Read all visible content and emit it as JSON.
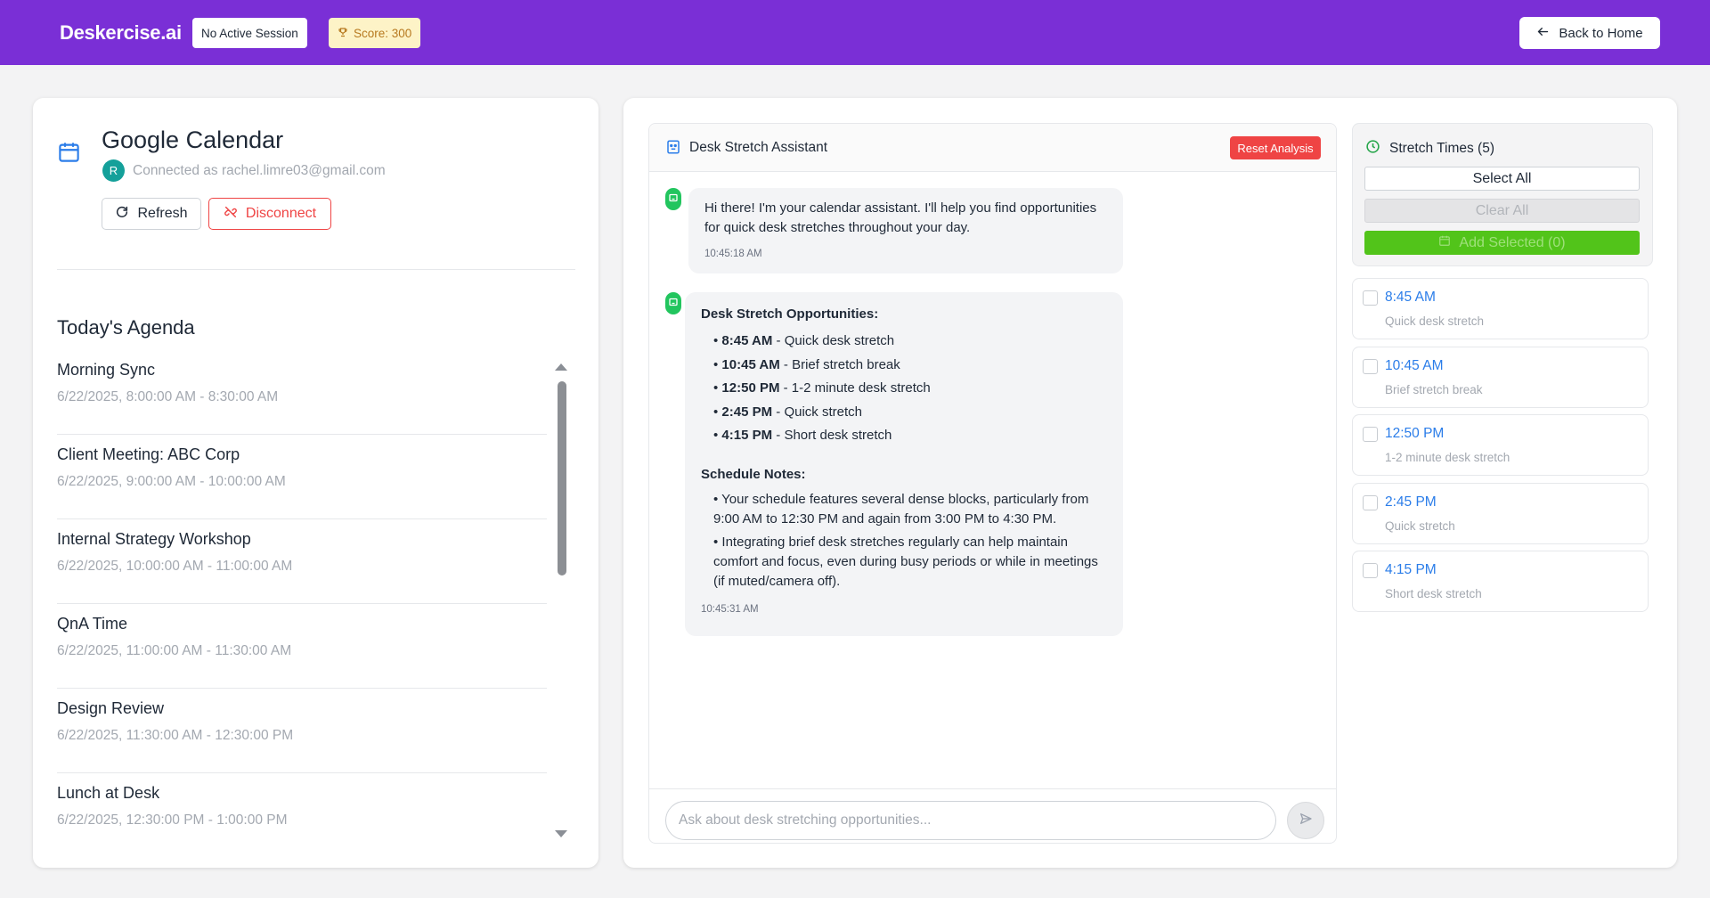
{
  "header": {
    "brand": "Deskercise.ai",
    "session_status": "No Active Session",
    "score_label": "Score: 300",
    "back_button": "Back to Home"
  },
  "calendar": {
    "title": "Google Calendar",
    "avatar_initial": "R",
    "connected_as": "Connected as rachel.limre03@gmail.com",
    "refresh_label": "Refresh",
    "disconnect_label": "Disconnect",
    "agenda_title": "Today's Agenda",
    "agenda": [
      {
        "name": "Morning Sync",
        "time": "6/22/2025, 8:00:00 AM - 8:30:00 AM"
      },
      {
        "name": "Client Meeting: ABC Corp",
        "time": "6/22/2025, 9:00:00 AM - 10:00:00 AM"
      },
      {
        "name": "Internal Strategy Workshop",
        "time": "6/22/2025, 10:00:00 AM - 11:00:00 AM"
      },
      {
        "name": "QnA Time",
        "time": "6/22/2025, 11:00:00 AM - 11:30:00 AM"
      },
      {
        "name": "Design Review",
        "time": "6/22/2025, 11:30:00 AM - 12:30:00 PM"
      },
      {
        "name": "Lunch at Desk",
        "time": "6/22/2025, 12:30:00 PM - 1:00:00 PM"
      }
    ]
  },
  "chat": {
    "title": "Desk Stretch Assistant",
    "reset_label": "Reset Analysis",
    "message1": {
      "text": "Hi there! I'm your calendar assistant. I'll help you find opportunities for quick desk stretches throughout your day.",
      "time": "10:45:18 AM"
    },
    "message2": {
      "heading": "Desk Stretch Opportunities:",
      "items": [
        {
          "time": "8:45 AM",
          "desc": " - Quick desk stretch"
        },
        {
          "time": "10:45 AM",
          "desc": " - Brief stretch break"
        },
        {
          "time": "12:50 PM",
          "desc": " - 1-2 minute desk stretch"
        },
        {
          "time": "2:45 PM",
          "desc": " - Quick stretch"
        },
        {
          "time": "4:15 PM",
          "desc": " - Short desk stretch"
        }
      ],
      "notes_heading": "Schedule Notes:",
      "notes": [
        "Your schedule features several dense blocks, particularly from 9:00 AM to 12:30 PM and again from 3:00 PM to 4:30 PM.",
        "Integrating brief desk stretches regularly can help maintain comfort and focus, even during busy periods or while in meetings (if muted/camera off)."
      ],
      "time": "10:45:31 AM"
    },
    "input_placeholder": "Ask about desk stretching opportunities..."
  },
  "stretch": {
    "title": "Stretch Times (5)",
    "select_all": "Select All",
    "clear_all": "Clear All",
    "add_selected": "Add Selected (0)",
    "slots": [
      {
        "time": "8:45 AM",
        "desc": "Quick desk stretch"
      },
      {
        "time": "10:45 AM",
        "desc": "Brief stretch break"
      },
      {
        "time": "12:50 PM",
        "desc": "1-2 minute desk stretch"
      },
      {
        "time": "2:45 PM",
        "desc": "Quick stretch"
      },
      {
        "time": "4:15 PM",
        "desc": "Short desk stretch"
      }
    ]
  },
  "colors": {
    "header_bg": "#7a2fd6",
    "accent_red": "#ef4444",
    "accent_green": "#52c41a",
    "link_blue": "#2b7de9",
    "bot_green": "#22c55e"
  }
}
